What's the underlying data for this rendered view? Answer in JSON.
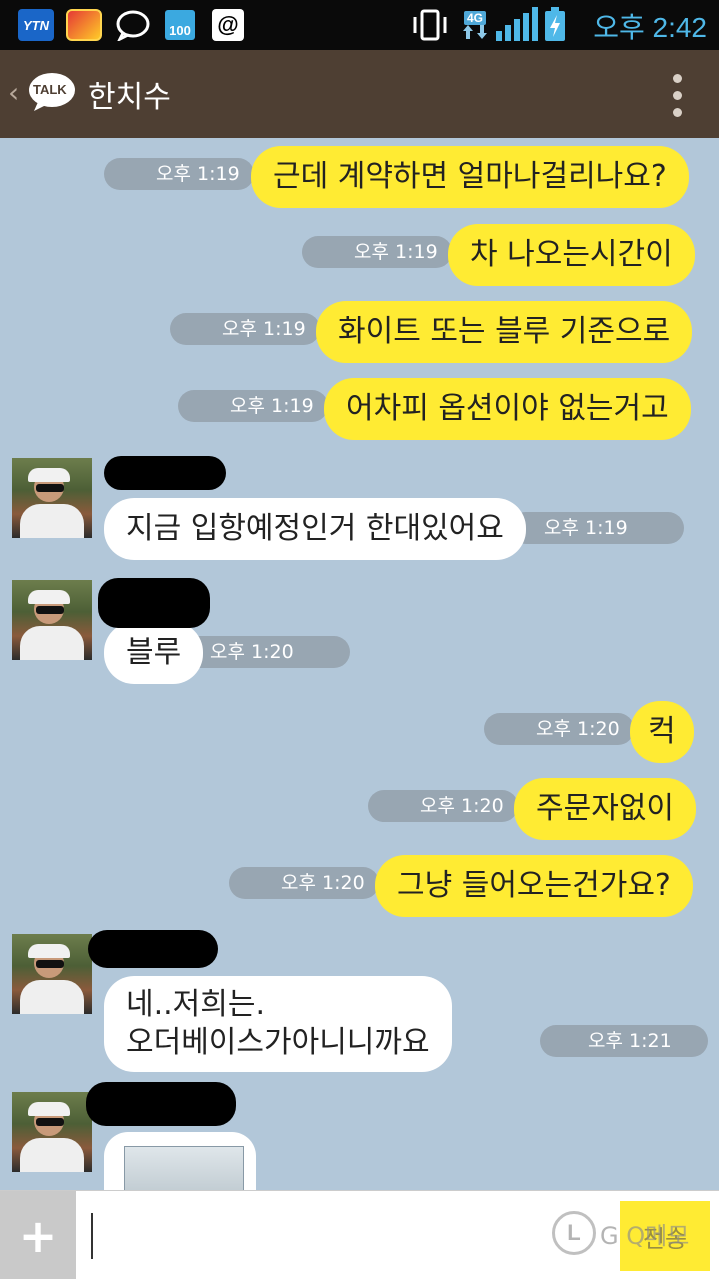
{
  "status_bar": {
    "ytn_label": "YTN",
    "battery_label": "100",
    "at_label": "@",
    "network_label": "4G",
    "clock": "오후 2:42"
  },
  "header": {
    "logo_label": "TALK",
    "title": "한치수"
  },
  "messages": [
    {
      "side": "sent",
      "text": "근데 계약하면 얼마나걸리나요?",
      "time": "오후 1:19"
    },
    {
      "side": "sent",
      "text": "차 나오는시간이",
      "time": "오후 1:19"
    },
    {
      "side": "sent",
      "text": "화이트 또는 블루 기준으로",
      "time": "오후 1:19"
    },
    {
      "side": "sent",
      "text": "어차피 옵션이야 없는거고",
      "time": "오후 1:19"
    },
    {
      "side": "recv",
      "text": "지금 입항예정인거 한대있어요",
      "time": "오후 1:19"
    },
    {
      "side": "recv",
      "text": "블루",
      "time": "오후 1:20"
    },
    {
      "side": "sent",
      "text": "컥",
      "time": "오후 1:20"
    },
    {
      "side": "sent",
      "text": "주문자없이",
      "time": "오후 1:20"
    },
    {
      "side": "sent",
      "text": "그냥 들어오는건가요?",
      "time": "오후 1:20"
    },
    {
      "side": "recv",
      "text": "네..저희는.\n오더베이스가아니니까요",
      "time": "오후 1:21"
    }
  ],
  "input": {
    "placeholder": "",
    "send_label": "전송",
    "plus_label": "+",
    "watermark": "G Q메모"
  },
  "colors": {
    "chat_bg": "#b2c7d9",
    "header_bg": "#4e3f33",
    "sent_bubble": "#ffeb33",
    "recv_bubble": "#ffffff",
    "time_pill": "#98a6b2"
  }
}
